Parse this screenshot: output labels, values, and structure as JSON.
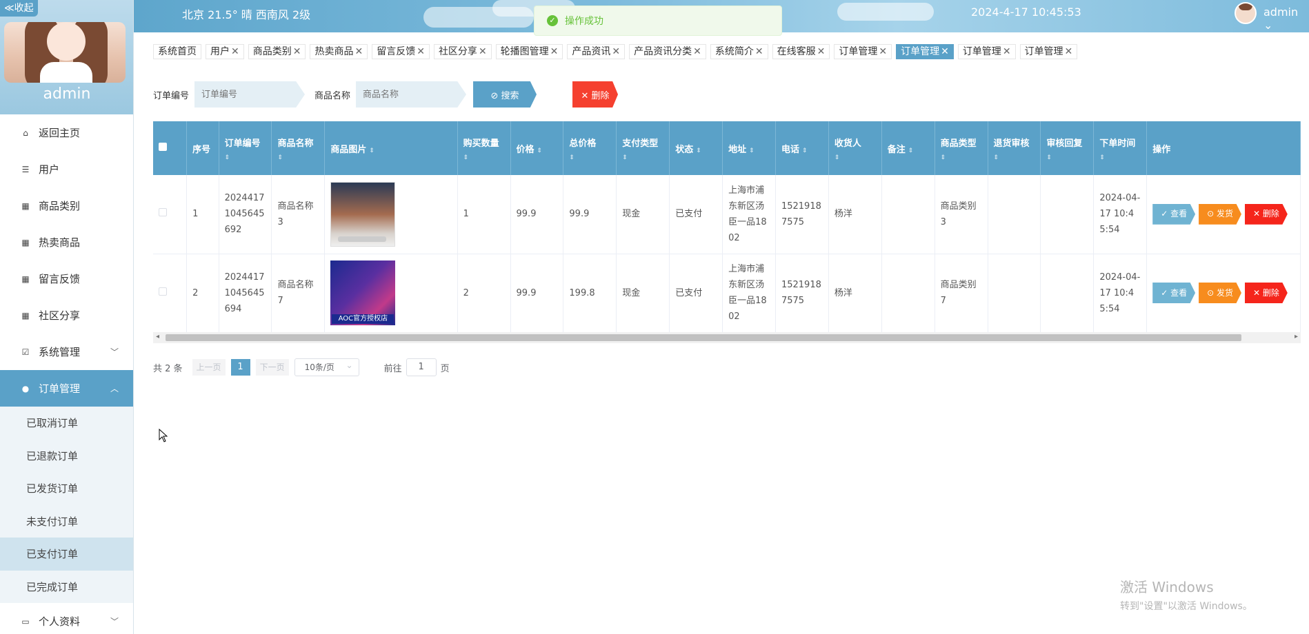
{
  "sidebar": {
    "collapse_label": "≪收起",
    "username": "admin",
    "menu": [
      {
        "icon": "home-icon",
        "glyph": "⌂",
        "label": "返回主页"
      },
      {
        "icon": "list-icon",
        "glyph": "☰",
        "label": "用户"
      },
      {
        "icon": "grid-icon",
        "glyph": "▦",
        "label": "商品类别"
      },
      {
        "icon": "grid-icon",
        "glyph": "▦",
        "label": "热卖商品"
      },
      {
        "icon": "grid-icon",
        "glyph": "▦",
        "label": "留言反馈"
      },
      {
        "icon": "grid-icon",
        "glyph": "▦",
        "label": "社区分享"
      },
      {
        "icon": "check-square-icon",
        "glyph": "☑",
        "label": "系统管理"
      },
      {
        "icon": "user-icon",
        "glyph": "●",
        "label": "订单管理"
      }
    ],
    "submenu": [
      "已取消订单",
      "已退款订单",
      "已发货订单",
      "未支付订单",
      "已支付订单",
      "已完成订单"
    ],
    "last_item": {
      "icon": "id-card-icon",
      "glyph": "▭",
      "label": "个人资料"
    }
  },
  "header": {
    "weather": "北京  21.5°  晴  西南风  2级",
    "datetime": "2024-4-17 10:45:53",
    "user": "admin ⌄"
  },
  "toast": {
    "message": "操作成功",
    "color": "#67c23a"
  },
  "tags": [
    {
      "label": "系统首页",
      "closable": false
    },
    {
      "label": "用户",
      "closable": true
    },
    {
      "label": "商品类别",
      "closable": true
    },
    {
      "label": "热卖商品",
      "closable": true
    },
    {
      "label": "留言反馈",
      "closable": true
    },
    {
      "label": "社区分享",
      "closable": true
    },
    {
      "label": "轮播图管理",
      "closable": true
    },
    {
      "label": "产品资讯",
      "closable": true
    },
    {
      "label": "产品资讯分类",
      "closable": true
    },
    {
      "label": "系统简介",
      "closable": true
    },
    {
      "label": "在线客服",
      "closable": true
    },
    {
      "label": "订单管理",
      "closable": true
    },
    {
      "label": "订单管理",
      "closable": true,
      "active": true
    },
    {
      "label": "订单管理",
      "closable": true
    },
    {
      "label": "订单管理",
      "closable": true
    }
  ],
  "search": {
    "order_no_label": "订单编号",
    "order_no_placeholder": "订单编号",
    "product_label": "商品名称",
    "product_placeholder": "商品名称",
    "search_button": "⊘ 搜索",
    "delete_button": "✕  删除"
  },
  "table": {
    "columns": [
      "序号",
      "订单编号",
      "商品名称",
      "商品图片",
      "购买数量",
      "价格",
      "总价格",
      "支付类型",
      "状态",
      "地址",
      "电话",
      "收货人",
      "备注",
      "商品类型",
      "退货审核",
      "审核回复",
      "下单时间",
      "操作"
    ],
    "rows": [
      {
        "index": "1",
        "order_no": "20244171045645692",
        "product": "商品名称3",
        "image": "imac-photo",
        "qty": "1",
        "price": "99.9",
        "total": "99.9",
        "pay_type": "现金",
        "status": "已支付",
        "address": "上海市浦东新区汤臣一品1802",
        "phone": "15219187575",
        "receiver": "杨洋",
        "remark": "",
        "category": "商品类别3",
        "return_review": "",
        "review_reply": "",
        "order_time": "2024-04-17 10:45:54"
      },
      {
        "index": "2",
        "order_no": "20244171045645694",
        "product": "商品名称7",
        "image": "keyboard-photo",
        "image_caption": "AOC官方授权店",
        "qty": "2",
        "price": "99.9",
        "total": "199.8",
        "pay_type": "现金",
        "status": "已支付",
        "address": "上海市浦东新区汤臣一品1802",
        "phone": "15219187575",
        "receiver": "杨洋",
        "remark": "",
        "category": "商品类别7",
        "return_review": "",
        "review_reply": "",
        "order_time": "2024-04-17 10:45:54"
      }
    ],
    "actions": {
      "view": "✓ 查看",
      "ship": "⊙ 发货",
      "delete": "✕ 删除"
    }
  },
  "pagination": {
    "total": "共 2 条",
    "prev": "上一页",
    "page": "1",
    "next": "下一页",
    "page_size": "10条/页",
    "goto_prefix": "前往",
    "goto_value": "1",
    "goto_suffix": "页"
  },
  "watermark": {
    "line1": "激活 Windows",
    "line2": "转到\"设置\"以激活 Windows。"
  },
  "colors": {
    "accent": "#5aa1c8",
    "danger": "#f5251b",
    "warning": "#f78c1e"
  }
}
